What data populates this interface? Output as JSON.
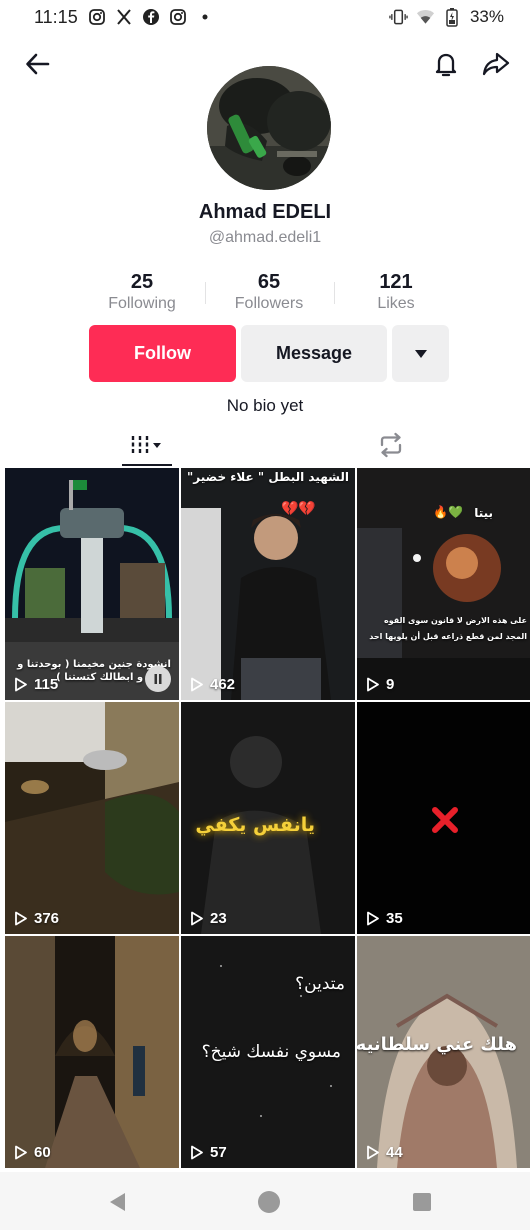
{
  "status_bar": {
    "time": "11:15",
    "battery": "33%",
    "icons": [
      "instagram-icon",
      "x-icon",
      "facebook-icon",
      "instagram-icon",
      "dot-icon",
      "vibrate-icon",
      "wifi-icon",
      "battery-icon"
    ]
  },
  "header": {
    "back_icon": "back-arrow-icon",
    "bell_icon": "bell-icon",
    "share_icon": "share-icon"
  },
  "profile": {
    "display_name": "Ahmad EDELI",
    "handle": "@ahmad.edeli1",
    "bio": "No bio yet"
  },
  "stats": [
    {
      "value": "25",
      "label": "Following"
    },
    {
      "value": "65",
      "label": "Followers"
    },
    {
      "value": "121",
      "label": "Likes"
    }
  ],
  "actions": {
    "follow_label": "Follow",
    "message_label": "Message",
    "more_icon": "caret-down-icon"
  },
  "colors": {
    "accent": "#fe2c55",
    "secondary_button": "#efeff0",
    "muted_text": "#8a8b91"
  },
  "tabs": [
    {
      "icon": "videos-grid-icon",
      "selected": true
    },
    {
      "icon": "repost-icon",
      "selected": false
    }
  ],
  "videos": [
    {
      "views": "115",
      "caption": "انشودة جنين مخيمنا ( بوحدتنا و قوتنا و ابطالك كتستنا )"
    },
    {
      "views": "462",
      "caption": "الشهيد البطل \" علاء خضير\""
    },
    {
      "views": "9",
      "caption": "بيتا",
      "caption2": "على هذه الارض لا قانون سوى القوه",
      "caption3": "المجد لمن قطع ذراعه قبل أن يلويها احد"
    },
    {
      "views": "376",
      "caption": ""
    },
    {
      "views": "23",
      "caption": "يانفس يكفي"
    },
    {
      "views": "35",
      "caption": ""
    },
    {
      "views": "60",
      "caption": ""
    },
    {
      "views": "57",
      "caption": "متدين؟",
      "caption2": "مسوي نفسك شيخ؟"
    },
    {
      "views": "44",
      "caption": "هلك عني سلطانيه"
    }
  ]
}
